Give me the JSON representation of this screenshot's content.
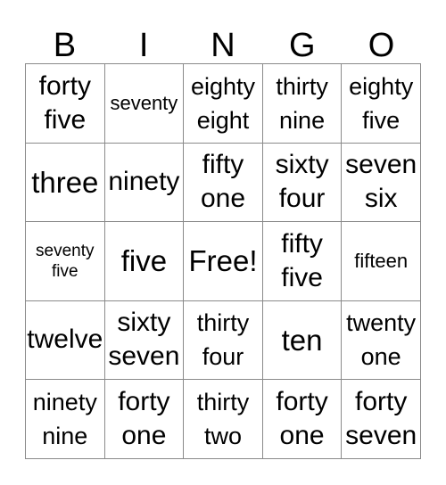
{
  "card": {
    "title": "BINGO",
    "headers": [
      "B",
      "I",
      "N",
      "G",
      "O"
    ],
    "free_label": "Free!",
    "border_color": "#8a8a8a",
    "text_color": "#000000",
    "background_color": "#ffffff",
    "rows": [
      [
        {
          "text": "forty five",
          "lines": [
            "forty",
            "five"
          ]
        },
        {
          "text": "seventy",
          "lines": [
            "seventy"
          ]
        },
        {
          "text": "eighty eight",
          "lines": [
            "eighty",
            "eight"
          ]
        },
        {
          "text": "thirty nine",
          "lines": [
            "thirty",
            "nine"
          ]
        },
        {
          "text": "eighty five",
          "lines": [
            "eighty",
            "five"
          ]
        }
      ],
      [
        {
          "text": "three",
          "lines": [
            "three"
          ]
        },
        {
          "text": "ninety",
          "lines": [
            "ninety"
          ]
        },
        {
          "text": "fifty one",
          "lines": [
            "fifty",
            "one"
          ]
        },
        {
          "text": "sixty four",
          "lines": [
            "sixty",
            "four"
          ]
        },
        {
          "text": "seven six",
          "lines": [
            "seven",
            "six"
          ]
        }
      ],
      [
        {
          "text": "seventy five",
          "lines": [
            "seventy",
            "five"
          ]
        },
        {
          "text": "five",
          "lines": [
            "five"
          ]
        },
        {
          "text": "Free!",
          "lines": [
            "Free!"
          ]
        },
        {
          "text": "fifty five",
          "lines": [
            "fifty",
            "five"
          ]
        },
        {
          "text": "fifteen",
          "lines": [
            "fifteen"
          ]
        }
      ],
      [
        {
          "text": "twelve",
          "lines": [
            "twelve"
          ]
        },
        {
          "text": "sixty seven",
          "lines": [
            "sixty",
            "seven"
          ]
        },
        {
          "text": "thirty four",
          "lines": [
            "thirty",
            "four"
          ]
        },
        {
          "text": "ten",
          "lines": [
            "ten"
          ]
        },
        {
          "text": "twenty one",
          "lines": [
            "twenty",
            "one"
          ]
        }
      ],
      [
        {
          "text": "ninety nine",
          "lines": [
            "ninety",
            "nine"
          ]
        },
        {
          "text": "forty one",
          "lines": [
            "forty",
            "one"
          ]
        },
        {
          "text": "thirty two",
          "lines": [
            "thirty",
            "two"
          ]
        },
        {
          "text": "forty one",
          "lines": [
            "forty",
            "one"
          ]
        },
        {
          "text": "forty seven",
          "lines": [
            "forty",
            "seven"
          ]
        }
      ]
    ]
  }
}
